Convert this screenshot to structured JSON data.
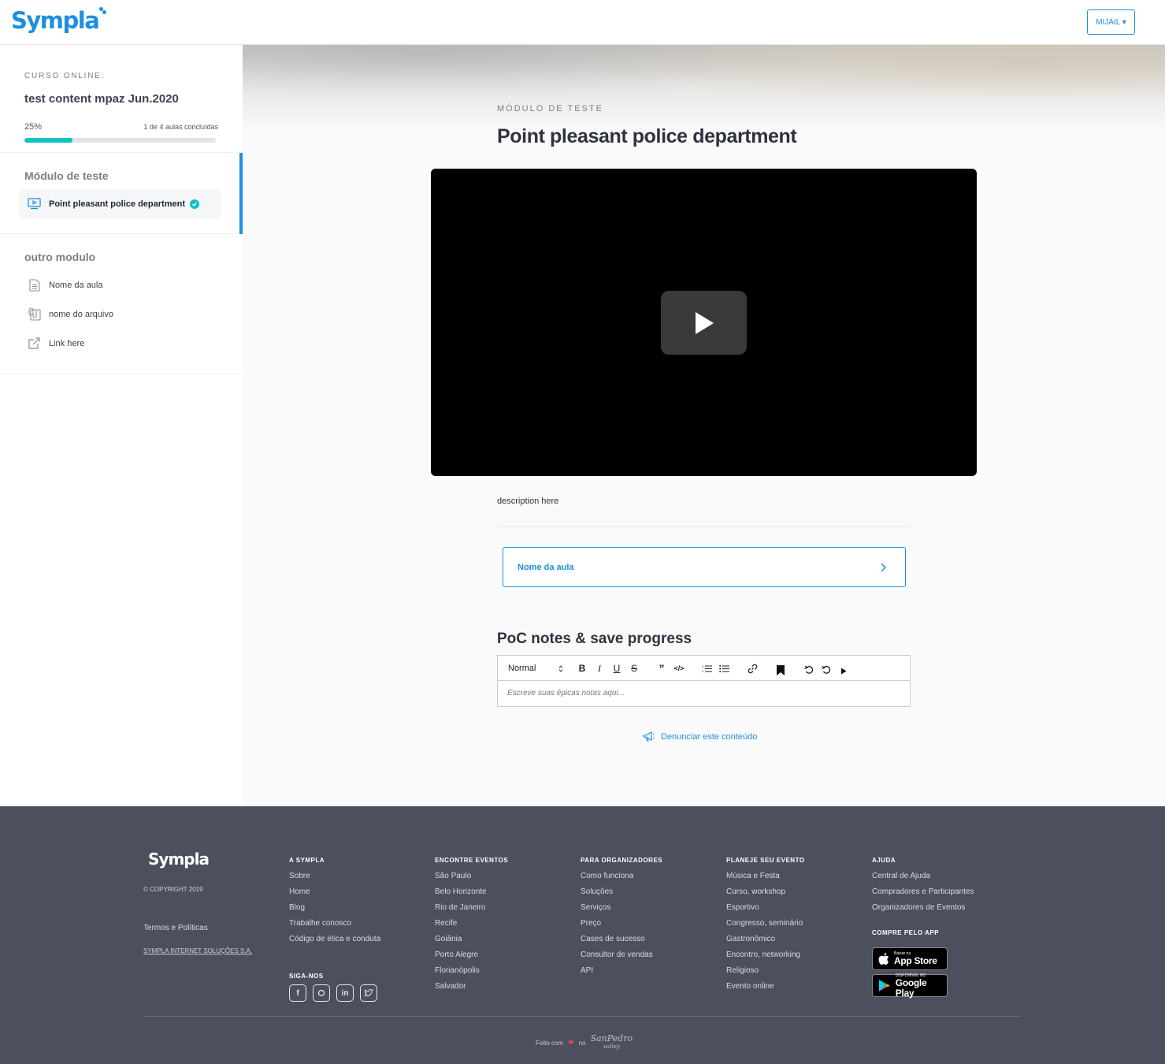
{
  "header": {
    "logo_text": "Sympla",
    "user_menu_label": "MIJAIL ▾"
  },
  "sidebar": {
    "course_label": "CURSO ONLINE:",
    "course_title": "test content mpaz Jun.2020",
    "progress_percent": "25%",
    "progress_fraction": 0.25,
    "progress_count": "1 de 4 aulas concluídas",
    "modules": [
      {
        "title": "Módulo de teste",
        "lessons": [
          {
            "label": "Point pleasant police department",
            "icon": "video-lesson-icon",
            "completed": true
          }
        ]
      },
      {
        "title": "outro modulo",
        "lessons": [
          {
            "label": "Nome da aula",
            "icon": "document-icon"
          },
          {
            "label": "nome do arquivo",
            "icon": "attachment-icon"
          },
          {
            "label": "Link here",
            "icon": "external-link-icon"
          }
        ]
      }
    ]
  },
  "main": {
    "module_label": "MÓDULO DE TESTE",
    "lesson_title": "Point pleasant police department",
    "description": "description here",
    "next_lesson_label": "Nome da aula",
    "notes_title": "PoC notes & save progress",
    "editor": {
      "format_select": "Normal",
      "placeholder": "Escreve suas épicas notas aqui..."
    },
    "report_label": "Denunciar este conteúdo"
  },
  "footer": {
    "logo_text": "Sympla",
    "copyright": "© COPYRIGHT 2019",
    "terms": "Termos e Políticas",
    "company": "SYMPLA INTERNET SOLUÇÕES S.A.",
    "columns": [
      {
        "title": "A SYMPLA",
        "links": [
          "Sobre",
          "Home",
          "Blog",
          "Trabalhe conosco",
          "Código de ética e conduta"
        ]
      },
      {
        "title": "ENCONTRE EVENTOS",
        "links": [
          "São Paulo",
          "Belo Horizonte",
          "Rio de Janeiro",
          "Recife",
          "Goiânia",
          "Porto Alegre",
          "Florianópolis",
          "Salvador"
        ]
      },
      {
        "title": "PARA ORGANIZADORES",
        "links": [
          "Como funciona",
          "Soluções",
          "Serviços",
          "Preço",
          "Cases de sucesso",
          "Consultor de vendas",
          "API"
        ]
      },
      {
        "title": "PLANEJE SEU EVENTO",
        "links": [
          "Música e Festa",
          "Curso, workshop",
          "Esportivo",
          "Congresso, seminário",
          "Gastronômico",
          "Encontro, networking",
          "Religioso",
          "Evento online"
        ]
      },
      {
        "title": "AJUDA",
        "links": [
          "Central de Ajuda",
          "Compradores e Participantes",
          "Organizadores de Eventos"
        ]
      }
    ],
    "follow_label": "SIGA-NOS",
    "app_label": "COMPRE PELO APP",
    "app_store": {
      "small": "Baixar na",
      "big": "App Store"
    },
    "google_play": {
      "small": "DISPONÍVEL NO",
      "big": "Google Play"
    },
    "made_with": "Feito com",
    "made_in": "no",
    "made_brand": "SanPedro",
    "made_brand_sub": "valley"
  },
  "colors": {
    "brand_blue": "#1d8fe1",
    "progress_teal": "#10c1c5",
    "footer_bg": "#4c4f5d"
  }
}
